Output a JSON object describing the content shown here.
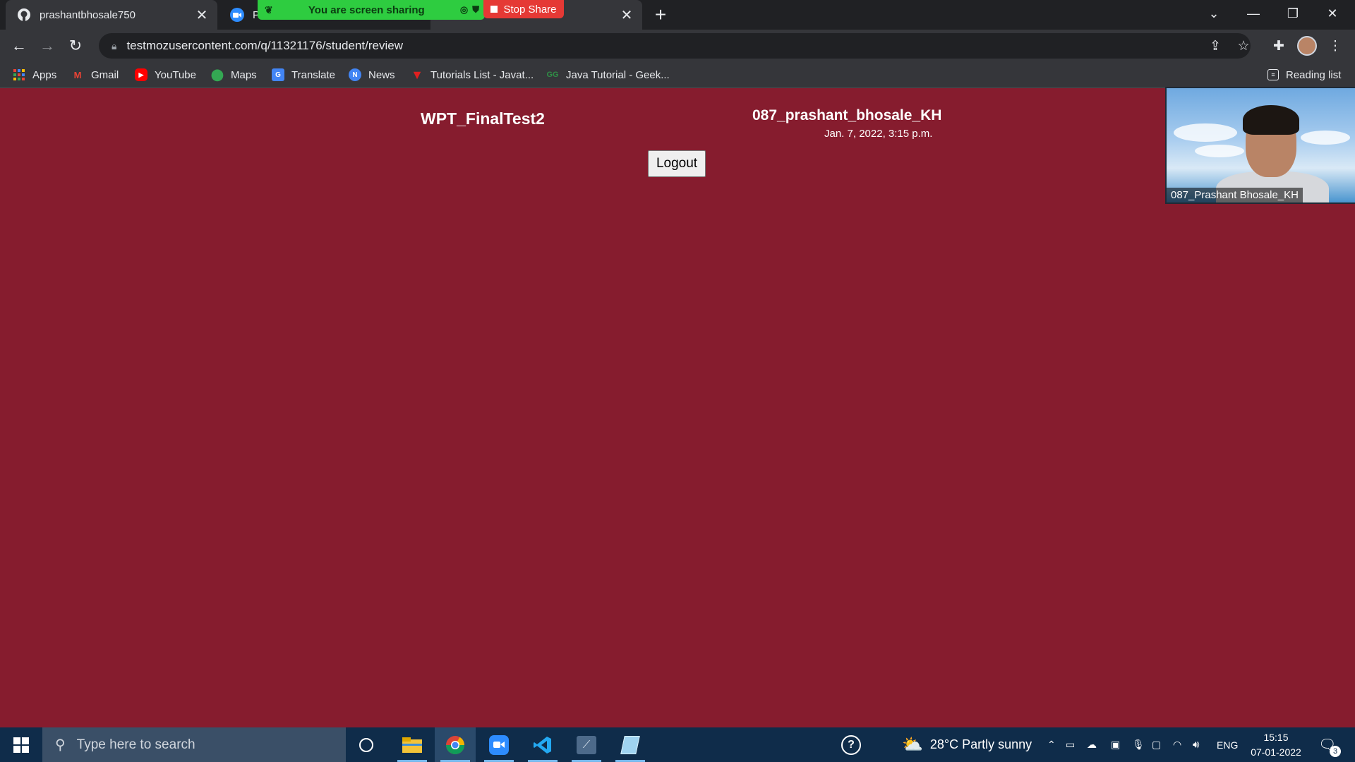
{
  "browser": {
    "tabs": [
      {
        "title": "prashantbhosale750",
        "icon": "github-icon"
      },
      {
        "title": "Pe",
        "icon": "zoom-icon"
      },
      {
        "title": "",
        "icon": "tab-icon"
      }
    ],
    "url": "testmozusercontent.com/q/11321176/student/review",
    "bookmarks": [
      {
        "label": "Apps"
      },
      {
        "label": "Gmail"
      },
      {
        "label": "YouTube"
      },
      {
        "label": "Maps"
      },
      {
        "label": "Translate"
      },
      {
        "label": "News"
      },
      {
        "label": "Tutorials List - Javat..."
      },
      {
        "label": "Java Tutorial - Geek..."
      }
    ],
    "reading_list": "Reading list"
  },
  "share": {
    "banner": "You are screen sharing",
    "stop": "Stop Share"
  },
  "page": {
    "test_title": "WPT_FinalTest2",
    "user_name": "087_prashant_bhosale_KH",
    "timestamp": "Jan. 7, 2022, 3:15 p.m.",
    "logout": "Logout"
  },
  "video": {
    "label": "087_Prashant Bhosale_KH"
  },
  "taskbar": {
    "search_placeholder": "Type here to search",
    "weather": "28°C  Partly sunny",
    "lang": "ENG",
    "time": "15:15",
    "date": "07-01-2022",
    "notifications": "3"
  },
  "colors": {
    "page_bg": "#861c2e",
    "share_green": "#2ecc40",
    "stop_red": "#e53935"
  }
}
